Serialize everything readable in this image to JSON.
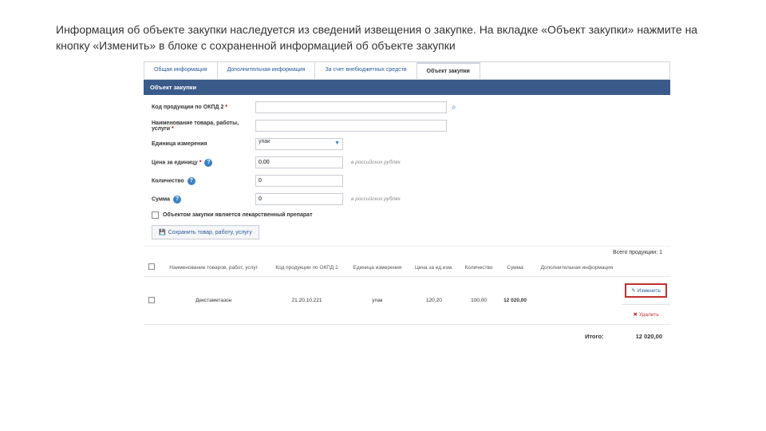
{
  "instruction": "Информация об объекте закупки наследуется из сведений извещения о закупке. На вкладке «Объект закупки» нажмите на кнопку «Изменить» в блоке с сохраненной информацией об объекте закупки",
  "tabs": {
    "t1": "Общая информация",
    "t2": "Дополнительная информация",
    "t3": "За счет внебюджетных средств",
    "t4": "Объект закупки"
  },
  "section_title": "Объект закупки",
  "form": {
    "okpd_label": "Код продукции по ОКПД 2",
    "name_label": "Наименование товара, работы, услуги",
    "unit_label": "Единица измерения",
    "unit_value": "упак",
    "price_label": "Цена за единицу",
    "price_value": "0,00",
    "qty_label": "Количество",
    "qty_value": "0",
    "sum_label": "Сумма",
    "sum_value": "0",
    "rub_note": "в российских рублях",
    "drug_checkbox": "Объектом закупки является лекарственный препарат",
    "save_btn": "Сохранить товар, работу, услугу"
  },
  "positions": {
    "count_label": "Всего продукции: 1"
  },
  "table": {
    "headers": {
      "name": "Наименование товаров, работ, услуг",
      "okpd": "Код продукции по ОКПД 2",
      "unit": "Единица измерения",
      "price": "Цена за ед.изм.",
      "qty": "Количество",
      "sum": "Сумма",
      "extra": "Дополнительная информация"
    },
    "row": {
      "name": "Декстаметазон",
      "okpd": "21.20.10.221",
      "unit": "упак",
      "price": "120,20",
      "qty": "100,00",
      "sum": "12 020,00"
    },
    "edit_btn": "Изменить",
    "delete_btn": "Удалить"
  },
  "total": {
    "label": "Итого:",
    "value": "12 020,00"
  }
}
